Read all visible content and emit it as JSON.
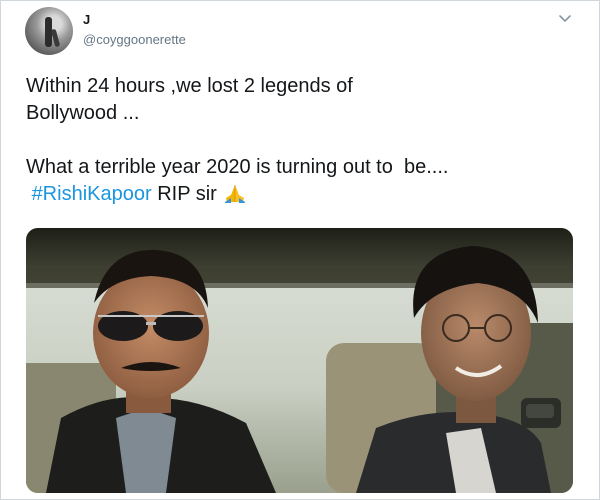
{
  "tweet": {
    "author": {
      "display_name": "J",
      "handle": "@coyggoonerette"
    },
    "text": {
      "line1": "Within 24 hours ,we lost 2 legends of",
      "line2": "Bollywood ...",
      "line3": "What a terrible year 2020 is turning out to  be....",
      "hashtag": "#RishiKapoor",
      "tail": " RIP sir "
    },
    "icons": {
      "menu": "chevron-down-icon",
      "emoji": "folded-hands-icon"
    },
    "colors": {
      "hashtag": "#1b95e0",
      "secondary_text": "#657786",
      "primary_text": "#14171a"
    }
  }
}
